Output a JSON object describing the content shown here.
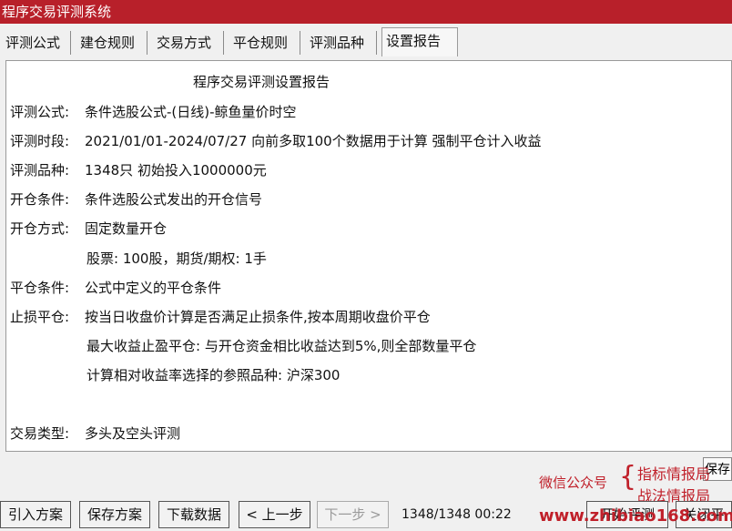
{
  "window": {
    "title": "程序交易评测系统"
  },
  "tabs": [
    {
      "label": "评测公式"
    },
    {
      "label": "建仓规则"
    },
    {
      "label": "交易方式"
    },
    {
      "label": "平仓规则"
    },
    {
      "label": "评测品种"
    },
    {
      "label": "设置报告",
      "active": true
    }
  ],
  "report": {
    "title": "程序交易评测设置报告",
    "formula_label": "评测公式:",
    "formula_value": "条件选股公式-(日线)-鲸鱼量价时空",
    "period_label": "评测时段:",
    "period_value": "2021/01/01-2024/07/27 向前多取100个数据用于计算 强制平仓计入收益",
    "variety_label": "评测品种:",
    "variety_value": "1348只 初始投入1000000元",
    "open_cond_label": "开仓条件:",
    "open_cond_value": "条件选股公式发出的开仓信号",
    "open_mode_label": "开仓方式:",
    "open_mode_value": "固定数量开仓",
    "open_mode_detail": "股票: 100股，期货/期权: 1手",
    "close_cond_label": "平仓条件:",
    "close_cond_value": "公式中定义的平仓条件",
    "stop_label": "止损平仓:",
    "stop_value": "按当日收盘价计算是否满足止损条件,按本周期收盘价平仓",
    "stop_detail1": "最大收益止盈平仓: 与开仓资金相比收益达到5%,则全部数量平仓",
    "stop_detail2": "计算相对收益率选择的参照品种: 沪深300",
    "trade_type_label": "交易类型:",
    "trade_type_value": "多头及空头评测"
  },
  "side_button": {
    "label": "保存"
  },
  "watermark": {
    "wechat": "微信公众号",
    "brace": "{",
    "line1": "指标情报局",
    "line2": "战法情报局",
    "url": "www.zhibiao168.com"
  },
  "bottom": {
    "import_label": "引入方案",
    "save_label": "保存方案",
    "download_label": "下载数据",
    "prev_label": "< 上一步",
    "next_label": "下一步 >",
    "status": "1348/1348 00:22",
    "start_label": "开始评测",
    "close_label": "关闭平"
  }
}
